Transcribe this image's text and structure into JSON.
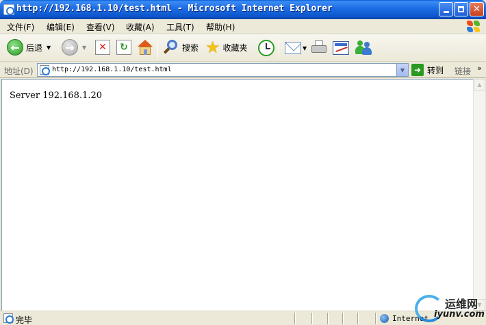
{
  "window": {
    "title": "http://192.168.1.10/test.html - Microsoft Internet Explorer",
    "minimize": "",
    "maximize": "",
    "close": "✕"
  },
  "menu": {
    "items": [
      "文件(F)",
      "编辑(E)",
      "查看(V)",
      "收藏(A)",
      "工具(T)",
      "帮助(H)"
    ]
  },
  "toolbar": {
    "back_label": "后退",
    "search_label": "搜索",
    "favorites_label": "收藏夹"
  },
  "address": {
    "label": "地址(D)",
    "url": "http://192.168.1.10/test.html",
    "go_label": "转到",
    "links_label": "链接"
  },
  "page": {
    "text": "Server 192.168.1.20"
  },
  "status": {
    "text": "完毕",
    "zone": "Internet"
  },
  "watermark": {
    "cn": "运维网",
    "en": "iyunv.com"
  },
  "icons": {
    "back": "back-arrow-icon",
    "forward": "forward-arrow-icon",
    "stop": "stop-icon",
    "refresh": "refresh-icon",
    "home": "home-icon",
    "search": "search-icon",
    "favorites": "star-icon",
    "history": "history-icon",
    "mail": "mail-icon",
    "print": "printer-icon",
    "edit": "edit-icon",
    "messenger": "messenger-icon"
  }
}
